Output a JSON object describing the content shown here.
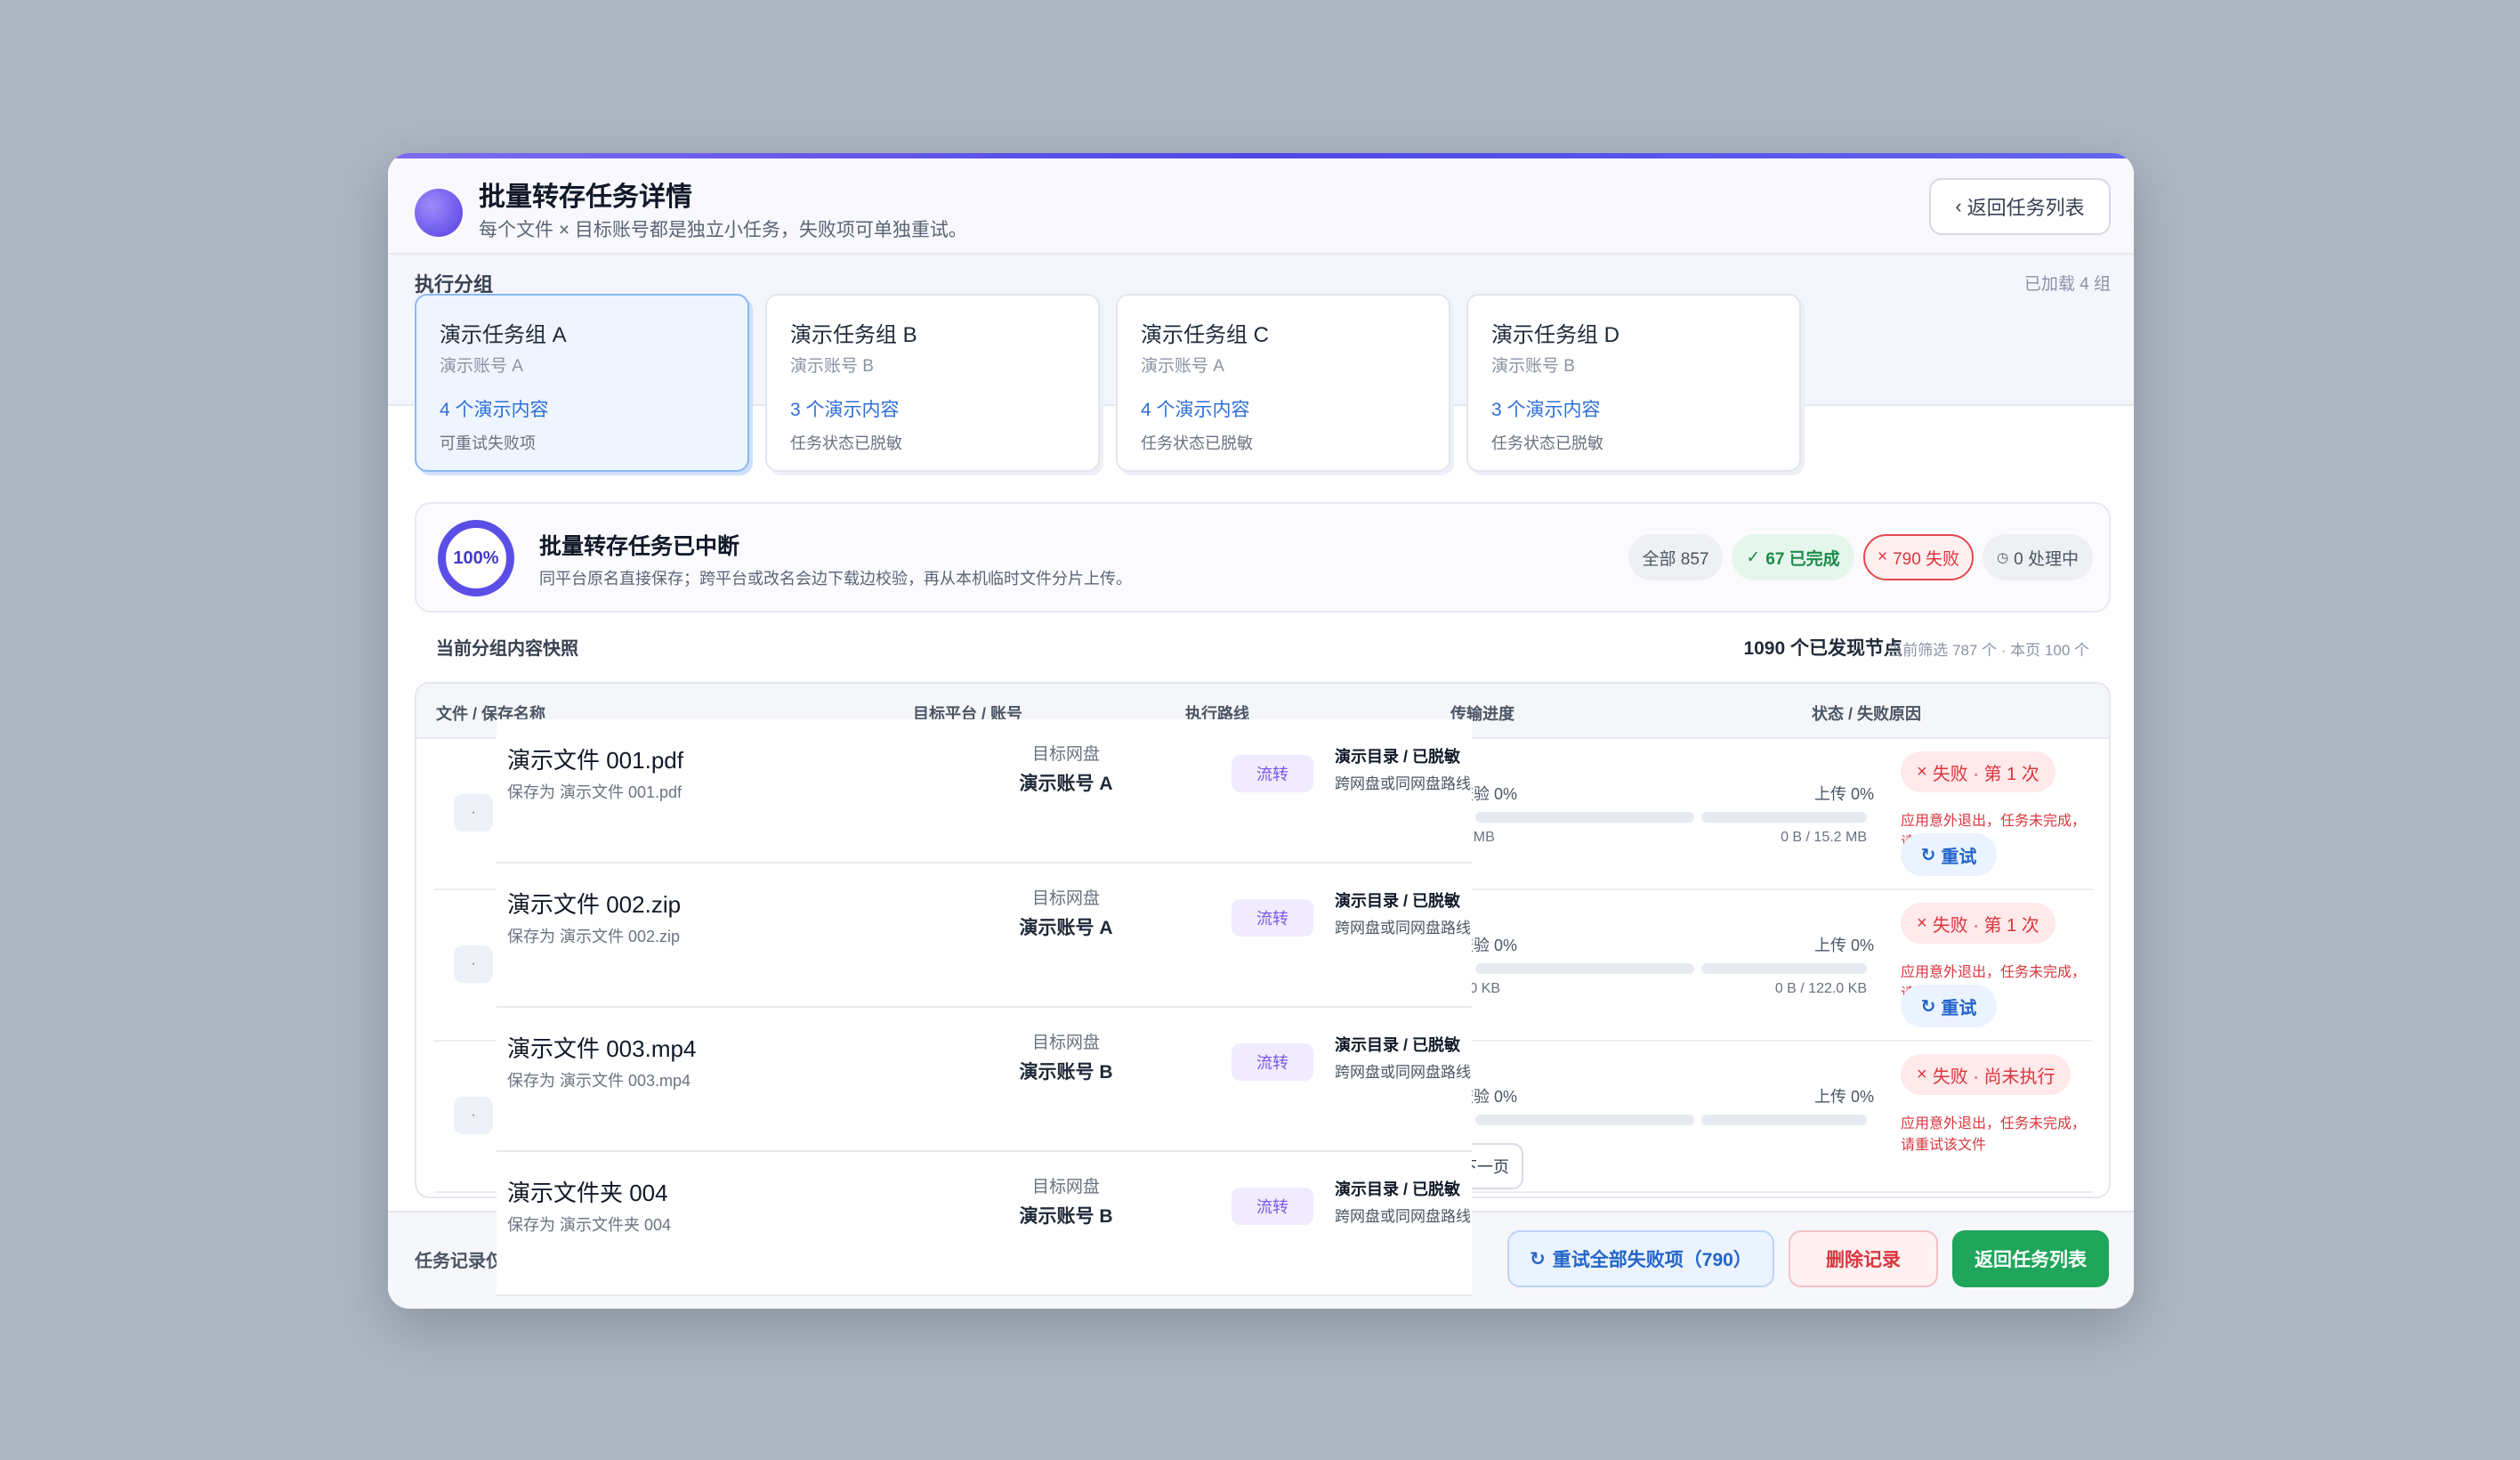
{
  "header": {
    "title": "批量转存任务详情",
    "subtitle": "每个文件 × 目标账号都是独立小任务，失败项可单独重试。",
    "back_button": "返回任务列表"
  },
  "groups": {
    "label": "执行分组",
    "loaded": "已加载 4 组",
    "items": [
      {
        "name": "演示任务组 A",
        "account": "演示账号 A",
        "count": "4 个演示内容",
        "status": "可重试失败项"
      },
      {
        "name": "演示任务组 B",
        "account": "演示账号 B",
        "count": "3 个演示内容",
        "status": "任务状态已脱敏"
      },
      {
        "name": "演示任务组 C",
        "account": "演示账号 A",
        "count": "4 个演示内容",
        "status": "任务状态已脱敏"
      },
      {
        "name": "演示任务组 D",
        "account": "演示账号 B",
        "count": "3 个演示内容",
        "status": "任务状态已脱敏"
      }
    ]
  },
  "status": {
    "percent": "100%",
    "title": "批量转存任务已中断",
    "desc": "同平台原名直接保存；跨平台或改名会边下载边校验，再从本机临时文件分片上传。",
    "chips": {
      "all": "全部 857",
      "done": "67 已完成",
      "failed": "790 失败",
      "processing": "0 处理中"
    }
  },
  "snapshot": {
    "label": "当前分组内容快照",
    "nodes": "1090 个已发现节点",
    "filter": "当前筛选 787 个 · 本页 100 个"
  },
  "table": {
    "headers": [
      "文件 / 保存名称",
      "目标平台 / 账号",
      "执行路线",
      "传输进度",
      "状态 / 失败原因"
    ],
    "rows": [
      {
        "idx": "·",
        "left_label": "校验 0%",
        "right_label": "上传 0%",
        "size_left": ".2 MB",
        "size_right": "0 B / 15.2 MB",
        "badge": "失败 · 第 1 次",
        "reason": "应用意外退出，任务未完成，请重试该文件",
        "retry": "重试"
      },
      {
        "idx": "·",
        "left_label": "校验 0%",
        "right_label": "上传 0%",
        "size_left": "2.0 KB",
        "size_right": "0 B / 122.0 KB",
        "badge": "失败 · 第 1 次",
        "reason": "应用意外退出，任务未完成，请重试该文件",
        "retry": "重试"
      },
      {
        "idx": "·",
        "left_label": "校验 0%",
        "right_label": "上传 0%",
        "size_left": "",
        "size_right": "",
        "badge": "失败 · 尚未执行",
        "reason": "应用意外退出，任务未完成，请重试该文件",
        "retry": ""
      }
    ],
    "pager_next": "下一页"
  },
  "overlay_rows": [
    {
      "name": "演示文件 001.pdf",
      "save": "保存为 演示文件 001.pdf",
      "platform": "目标网盘",
      "account": "演示账号 A",
      "tag": "流转",
      "dir": "演示目录 / 已脱敏",
      "route": "跨网盘或同网盘路线"
    },
    {
      "name": "演示文件 002.zip",
      "save": "保存为 演示文件 002.zip",
      "platform": "目标网盘",
      "account": "演示账号 A",
      "tag": "流转",
      "dir": "演示目录 / 已脱敏",
      "route": "跨网盘或同网盘路线"
    },
    {
      "name": "演示文件 003.mp4",
      "save": "保存为 演示文件 003.mp4",
      "platform": "目标网盘",
      "account": "演示账号 B",
      "tag": "流转",
      "dir": "演示目录 / 已脱敏",
      "route": "跨网盘或同网盘路线"
    },
    {
      "name": "演示文件夹 004",
      "save": "保存为 演示文件夹 004",
      "platform": "目标网盘",
      "account": "演示账号 B",
      "tag": "流转",
      "dir": "演示目录 / 已脱敏",
      "route": "跨网盘或同网盘路线"
    }
  ],
  "footer": {
    "note": "任务记录仅",
    "retry_all": "重试全部失败项（790）",
    "delete": "删除记录",
    "back": "返回任务列表"
  },
  "colors": {
    "accent": "#5b4ee6",
    "success": "#1fa65a",
    "danger": "#d9363e",
    "link": "#2f6fd6"
  }
}
